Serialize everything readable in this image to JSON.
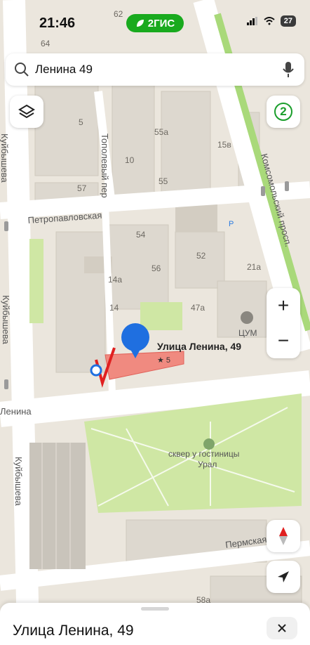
{
  "status_bar": {
    "time": "21:46",
    "brand": "2ГИС",
    "battery": "27"
  },
  "search": {
    "query": "Ленина 49"
  },
  "layers_badge": "2",
  "zoom": {
    "in": "+",
    "out": "−"
  },
  "map": {
    "streets": {
      "petropavlovskaya": "Петропавловская",
      "kuybysheva": "Куйбышева",
      "lenina": "Ленина",
      "komsomolsky": "Комсомольский просп.",
      "topolevy": "Тополевый пер",
      "permskaya": "Пермская"
    },
    "buildings": [
      "64",
      "62",
      "5",
      "55а",
      "10",
      "55",
      "15в",
      "57",
      "54",
      "56",
      "52",
      "14а",
      "14",
      "47а",
      "21а",
      "58а"
    ],
    "poi": {
      "tsum": "ЦУМ",
      "square_line1": "сквер у гостиницы",
      "square_line2": "Урал",
      "parking": "P"
    },
    "selected": {
      "label": "Улица Ленина, 49",
      "rating": "★ 5"
    }
  },
  "sheet": {
    "title": "Улица Ленина, 49"
  },
  "colors": {
    "brand": "#19aa1e",
    "pin": "#1f6fe0",
    "highlight": "#f08a80",
    "park": "#cfe7a4"
  }
}
